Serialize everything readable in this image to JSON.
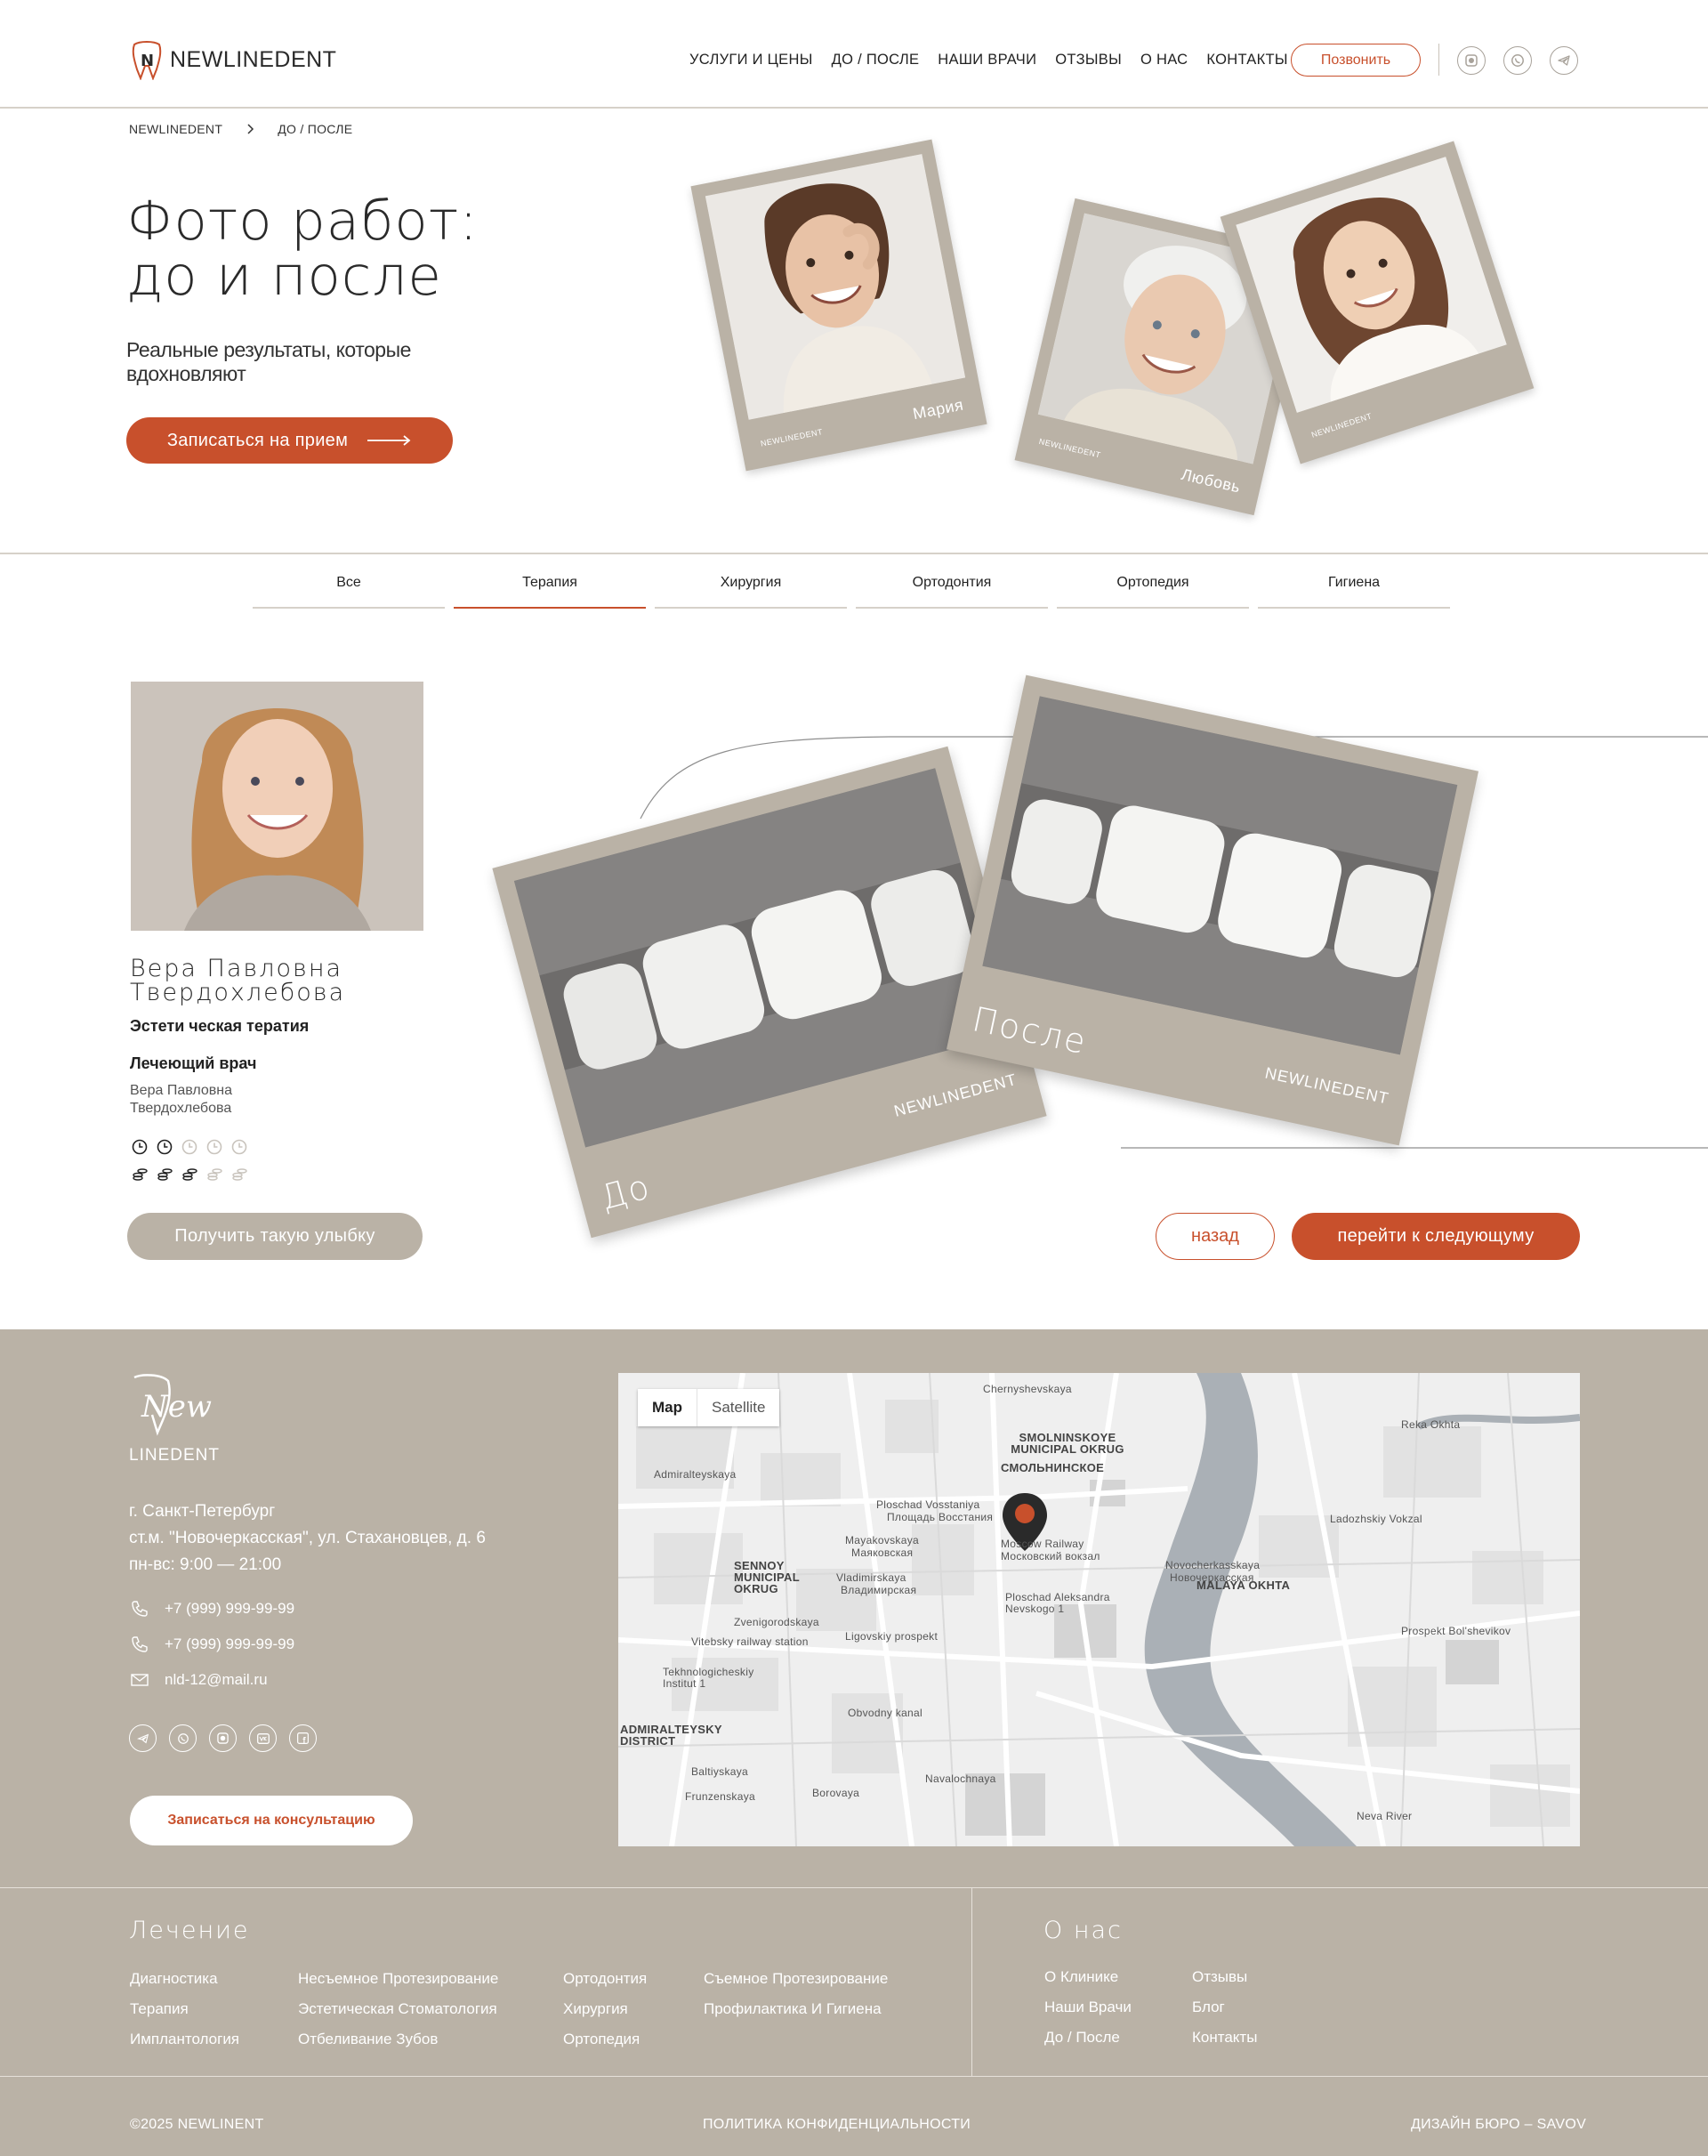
{
  "header": {
    "logo_text": "NEWLINEDENT",
    "nav": [
      "УСЛУГИ И ЦЕНЫ",
      "ДО / ПОСЛЕ",
      "НАШИ ВРАЧИ",
      "ОТЗЫВЫ",
      "О НАС",
      "КОНТАКТЫ"
    ],
    "call_label": "Позвонить",
    "social_icons": [
      "record-icon",
      "whatsapp-icon",
      "telegram-icon"
    ]
  },
  "breadcrumb": {
    "home": "NEWLINEDENT",
    "current": "ДО / ПОСЛЕ"
  },
  "hero": {
    "title_line1": "Фото работ:",
    "title_line2": "до и после",
    "subtitle": "Реальные результаты, которые вдохновляют",
    "cta": "Записаться на прием",
    "polaroids": [
      {
        "caption": "Мария",
        "brand": "NEWLINEDENT"
      },
      {
        "caption": "Любовь",
        "brand": "NEWLINEDENT"
      },
      {
        "caption": "",
        "brand": "NEWLINEDENT"
      }
    ]
  },
  "tabs": {
    "items": [
      "Все",
      "Терапия",
      "Хирургия",
      "Ортодонтия",
      "Ортопедия",
      "Гигиена"
    ],
    "active": "Терапия"
  },
  "case": {
    "doctor_name_line1": "Вера Павловна",
    "doctor_name_line2": "Твердохлебова",
    "specialty": "Эстети ческая тератия",
    "treating_label": "Лечеющий врач",
    "treating_doctor": "Вера Павловна Твердохлебова",
    "duration_level": "2/5",
    "cost_level": "3/5",
    "before_label": "До",
    "after_label": "После",
    "brand": "NEWLINEDENT",
    "smile_button": "Получить такую улыбку",
    "back_button": "назад",
    "next_button": "перейти к следующуму"
  },
  "footer": {
    "logo_line1": "New",
    "logo_line2": "LINEDENT",
    "address_city": "г. Санкт-Петербург",
    "address_street": "ст.м. \"Новочеркасская\", ул. Стахановцев, д. 6",
    "hours": "пн-вс: 9:00 — 21:00",
    "phone1": "+7 (999) 999-99-99",
    "phone2": "+7 (999) 999-99-99",
    "email": "nld-12@mail.ru",
    "social_icons": [
      "telegram-icon",
      "whatsapp-icon",
      "record-icon",
      "vk-icon",
      "facebook-icon"
    ],
    "consult_button": "Записаться на консультацию",
    "map": {
      "toggle_map": "Map",
      "toggle_satellite": "Satellite",
      "labels": [
        "Chernyshevskaya",
        "SMOLNINSKOYE MUNICIPAL OKRUG",
        "СМОЛЬНИНСКОЕ",
        "Ploschad Vosstaniya",
        "Площадь Восстания",
        "Mayakovskaya",
        "Маяковская",
        "Moscow Railway",
        "Московский вокзал",
        "Vladimirskaya",
        "Владимирская",
        "Ploschad Aleksandra Nevskogo 1",
        "Novocherkasskaya",
        "Новочеркасская",
        "Ladozhskiy Vokzal",
        "Zvenigorodskaya",
        "Ligovskiy prospekt",
        "Vitebsky railway station",
        "Tekhnologicheskiy Institut 1",
        "Obvodny kanal",
        "Navalochnaya",
        "Borovaya",
        "Frunzenskaya",
        "Baltiyskaya",
        "Prospekt Bol'shevikov",
        "MALAYA OKHTA",
        "ADMIRALTEYSKY DISTRICT",
        "Admiralteyskaya",
        "SENNOY MUNICIPAL OKRUG",
        "Reka Okhta",
        "Neva River"
      ]
    },
    "treatment_heading": "Лечение",
    "treatment_links": [
      [
        "Диагностика",
        "Терапия",
        "Имплантология"
      ],
      [
        "Несъемное Протезирование",
        "Эстетическая Стоматология",
        "Отбеливание Зубов"
      ],
      [
        "Ортодонтия",
        "Хирургия",
        "Ортопедия"
      ],
      [
        "Съемное Протезирование",
        "Профилактика И Гигиена"
      ]
    ],
    "about_heading": "О нас",
    "about_links": [
      [
        "О Клинике",
        "Наши Врачи",
        "До / После"
      ],
      [
        "Отзывы",
        "Блог",
        "Контакты"
      ]
    ],
    "copyright": "©2025 NEWLINENT",
    "privacy": "ПОЛИТИКА КОНФИДЕНЦИАЛЬНОСТИ",
    "design": "ДИЗАЙН БЮРО – SAVOV"
  },
  "colors": {
    "accent": "#c8502c",
    "beige": "#bab2a6",
    "divider": "#d6d1c9",
    "text": "#222222"
  }
}
